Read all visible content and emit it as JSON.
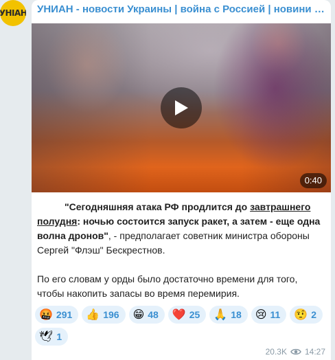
{
  "channel": {
    "avatar_text": "УНІАН",
    "title": "УНИАН - новости Украины | война с Россией | новини України | УНІАН"
  },
  "video": {
    "duration": "0:40",
    "play_icon": "play-icon"
  },
  "message": {
    "p1_quote_open": "\"Сегодняшняя атака РФ продлится до ",
    "p1_link": "завтрашнего полудня",
    "p1_quote_rest": ": ночью состоится запуск ракет, а затем - еще одна волна дронов",
    "p1_quote_close": "\"",
    "p1_tail": ", - предполагает советник министра обороны Сергей \"Флэш\" Бескрестнов.",
    "p2": "По его словам у орды было достаточно времени для того, чтобы накопить запасы во время перемирия."
  },
  "reactions": [
    {
      "emoji": "🤬",
      "count": "291"
    },
    {
      "emoji": "👍",
      "count": "196"
    },
    {
      "emoji": "😁",
      "count": "48"
    },
    {
      "emoji": "❤️",
      "count": "25"
    },
    {
      "emoji": "🙏",
      "count": "18"
    },
    {
      "emoji": "😢",
      "count": "11"
    },
    {
      "emoji": "🤨",
      "count": "2"
    },
    {
      "emoji": "🕊",
      "count": "1"
    }
  ],
  "meta": {
    "views": "20.3K",
    "views_icon": "eye-icon",
    "time": "14:27"
  },
  "colors": {
    "accent": "#3a8fd1",
    "reaction_bg": "#e5f1fb",
    "avatar_bg": "#f2c200",
    "page_bg": "#e6ebee"
  }
}
